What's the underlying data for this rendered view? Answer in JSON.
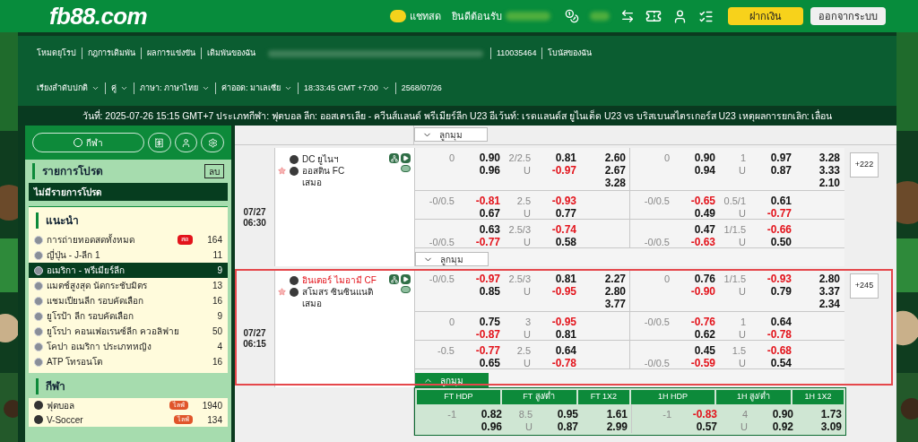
{
  "header": {
    "logo": "fb88.com",
    "chat": "แชทสด",
    "welcome": "ยินดีต้อนรับ",
    "deposit": "ฝากเงิน",
    "logout": "ออกจากระบบ"
  },
  "nav": {
    "links": [
      "โหมดยุโรป",
      "กฎการเดิมพัน",
      "ผลการแข่งขัน",
      "เดิมพันของฉัน"
    ],
    "account": "110035464",
    "bonus": "โบนัสของฉัน",
    "filters": [
      {
        "label": "เรียงลำดับปกติ",
        "dropdown": true
      },
      {
        "label": "คู่",
        "dropdown": true
      },
      {
        "label": "ภาษา: ภาษาไทย",
        "dropdown": true
      },
      {
        "label": "ค่าออด: มาเลเซีย",
        "dropdown": true
      },
      {
        "label": "18:33:45 GMT +7:00",
        "dropdown": true
      },
      {
        "label": "2568/07/26",
        "dropdown": false
      }
    ]
  },
  "ticker": "วันที่: 2025-07-26 15:15 GMT+7 ประเภทกีฬา: ฟุตบอล ลีก: ออสเตรเลีย - ควีนส์แลนด์ พรีเมียร์ลีก U23 อีเว้นท์: เรดแลนด์ส ยูไนเต็ด U23 vs บริสเบนสไตรเกอร์ส U23 เหตุผลการยกเลิก: เลื่อน",
  "sidebar": {
    "sports_tab": "กีฬา",
    "favorites": {
      "title": "รายการโปรด",
      "clear": "ลบ",
      "empty": "ไม่มีรายการโปรด"
    },
    "recommended": {
      "title": "แนะนำ",
      "items": [
        {
          "name": "การถ่ายทอดสดทั้งหมด",
          "badge": "สด",
          "count": "164",
          "selected": false
        },
        {
          "name": "ญี่ปุ่น - J-ลีก 1",
          "count": "11",
          "selected": false
        },
        {
          "name": "อเมริกา - พรีเมียร์ลีก",
          "count": "9",
          "selected": true
        },
        {
          "name": "แมตช์สูงสุด นัดกระชับมิตร",
          "count": "13",
          "selected": false
        },
        {
          "name": "แชมเปียนลีก รอบคัดเลือก",
          "count": "16",
          "selected": false
        },
        {
          "name": "ยูโรป้า ลีก รอบคัดเลือก",
          "count": "9",
          "selected": false
        },
        {
          "name": "ยูโรปา คอนเฟอเรนซ์ลีก ควอลิฟาย",
          "count": "50",
          "selected": false
        },
        {
          "name": "โคปา อเมริกา ประเภทหญิง",
          "count": "4",
          "selected": false
        },
        {
          "name": "ATP โทรอนโต",
          "count": "16",
          "selected": false
        }
      ]
    },
    "sports": {
      "title": "กีฬา",
      "items": [
        {
          "name": "ฟุตบอล",
          "badge": "ไลฟ์",
          "count": "1940"
        },
        {
          "name": "V-Soccer",
          "badge": "ไลฟ์",
          "count": "134"
        }
      ]
    }
  },
  "prev_corner": {
    "label": "ลูกมุม",
    "expanded": false
  },
  "matches": [
    {
      "date": "07/27",
      "time": "06:30",
      "highlighted": false,
      "home": {
        "name": "DC ยูไนฯ",
        "favorite": false
      },
      "away": {
        "name": "ออสติน FC",
        "favorite": false
      },
      "draw": "เสมอ",
      "more": "+222",
      "lines": [
        {
          "ft_hdp": {
            "line": "0",
            "line_on_away": false,
            "odds": [
              "0.90",
              "0.96"
            ]
          },
          "ft_ou": {
            "line": "2/2.5",
            "under": "U",
            "odds": [
              "0.81",
              "-0.97"
            ]
          },
          "ft_1x2": [
            "2.60",
            "2.67",
            "3.28"
          ],
          "h1_hdp": {
            "line": "0",
            "line_on_away": false,
            "odds": [
              "0.90",
              "0.94"
            ]
          },
          "h1_ou": {
            "line": "1",
            "under": "U",
            "odds": [
              "0.97",
              "0.87"
            ]
          },
          "h1_1x2": [
            "3.28",
            "3.33",
            "2.10"
          ]
        },
        {
          "ft_hdp": {
            "line": "-0/0.5",
            "line_on_away": false,
            "odds": [
              "-0.81",
              "0.67"
            ]
          },
          "ft_ou": {
            "line": "2.5",
            "under": "U",
            "odds": [
              "-0.93",
              "0.77"
            ]
          },
          "h1_hdp": {
            "line": "-0/0.5",
            "line_on_away": false,
            "odds": [
              "-0.65",
              "0.49"
            ]
          },
          "h1_ou": {
            "line": "0.5/1",
            "under": "U",
            "odds": [
              "0.61",
              "-0.77"
            ]
          }
        },
        {
          "ft_hdp": {
            "line": "-0/0.5",
            "line_on_away": true,
            "odds": [
              "0.63",
              "-0.77"
            ]
          },
          "ft_ou": {
            "line": "2.5/3",
            "under": "U",
            "odds": [
              "-0.74",
              "0.58"
            ]
          },
          "h1_hdp": {
            "line": "-0/0.5",
            "line_on_away": true,
            "odds": [
              "0.47",
              "-0.63"
            ]
          },
          "h1_ou": {
            "line": "1/1.5",
            "under": "U",
            "odds": [
              "-0.66",
              "0.50"
            ]
          }
        }
      ],
      "corner": {
        "label": "ลูกมุม",
        "expanded": false
      }
    },
    {
      "date": "07/27",
      "time": "06:15",
      "highlighted": true,
      "home": {
        "name": "อินเตอร์ ไมอามี CF",
        "favorite": true
      },
      "away": {
        "name": "สโมสร ซินซินแนติ",
        "favorite": false
      },
      "draw": "เสมอ",
      "more": "+245",
      "lines": [
        {
          "ft_hdp": {
            "line": "-0/0.5",
            "line_on_away": false,
            "odds": [
              "-0.97",
              "0.85"
            ]
          },
          "ft_ou": {
            "line": "2.5/3",
            "under": "U",
            "odds": [
              "0.81",
              "-0.95"
            ]
          },
          "ft_1x2": [
            "2.27",
            "2.80",
            "3.77"
          ],
          "h1_hdp": {
            "line": "0",
            "line_on_away": false,
            "odds": [
              "0.76",
              "-0.90"
            ]
          },
          "h1_ou": {
            "line": "1/1.5",
            "under": "U",
            "odds": [
              "-0.93",
              "0.79"
            ]
          },
          "h1_1x2": [
            "2.80",
            "3.37",
            "2.34"
          ]
        },
        {
          "ft_hdp": {
            "line": "0",
            "line_on_away": false,
            "odds": [
              "0.75",
              "-0.87"
            ]
          },
          "ft_ou": {
            "line": "3",
            "under": "U",
            "odds": [
              "-0.95",
              "0.81"
            ]
          },
          "h1_hdp": {
            "line": "-0/0.5",
            "line_on_away": false,
            "odds": [
              "-0.76",
              "0.62"
            ]
          },
          "h1_ou": {
            "line": "1",
            "under": "U",
            "odds": [
              "0.64",
              "-0.78"
            ]
          }
        },
        {
          "ft_hdp": {
            "line": "-0.5",
            "line_on_away": false,
            "odds": [
              "-0.77",
              "0.65"
            ]
          },
          "ft_ou": {
            "line": "2.5",
            "under": "U",
            "odds": [
              "0.64",
              "-0.78"
            ]
          },
          "h1_hdp": {
            "line": "-0/0.5",
            "line_on_away": true,
            "odds": [
              "0.45",
              "-0.59"
            ]
          },
          "h1_ou": {
            "line": "1.5",
            "under": "U",
            "odds": [
              "-0.68",
              "0.54"
            ]
          }
        }
      ],
      "corner": {
        "label": "ลูกมุม",
        "expanded": true,
        "columns": [
          "FT HDP",
          "FT สูง/ต่ำ",
          "FT 1X2",
          "1H HDP",
          "1H สูง/ต่ำ",
          "1H 1X2"
        ],
        "line": {
          "ft_hdp": {
            "line": "-1",
            "line_on_away": false,
            "odds": [
              "0.82",
              "0.96"
            ]
          },
          "ft_ou": {
            "line": "8.5",
            "under": "U",
            "odds": [
              "0.95",
              "0.87"
            ]
          },
          "ft_1x2": [
            "1.61",
            "2.99"
          ],
          "h1_hdp": {
            "line": "-1",
            "line_on_away": false,
            "odds": [
              "-0.83",
              "0.57"
            ]
          },
          "h1_ou": {
            "line": "4",
            "under": "U",
            "odds": [
              "0.90",
              "0.92"
            ]
          },
          "h1_1x2": [
            "1.73",
            "3.09"
          ]
        }
      }
    }
  ]
}
